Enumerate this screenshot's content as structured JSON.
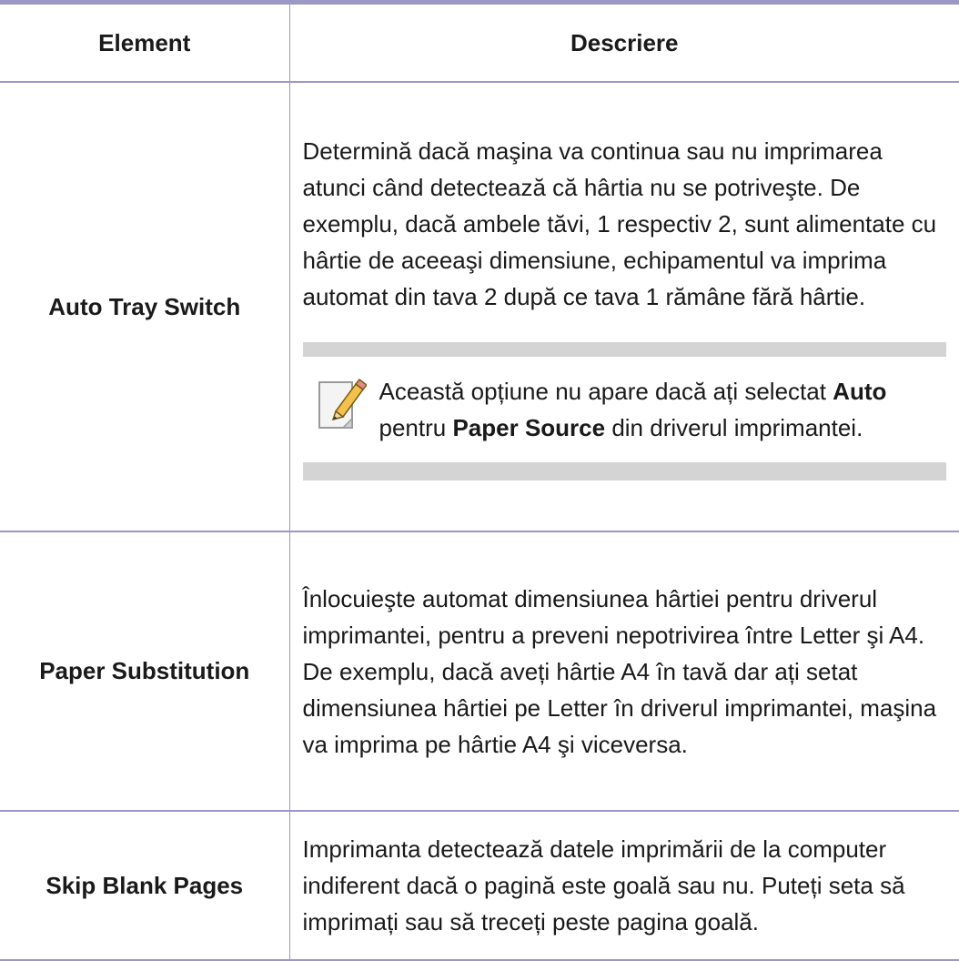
{
  "table": {
    "headers": {
      "element": "Element",
      "description": "Descriere"
    },
    "rows": [
      {
        "element": "Auto Tray Switch",
        "description": "Determină dacă maşina va continua sau nu imprimarea atunci când detectează că hârtia nu se potriveşte. De exemplu, dacă ambele tăvi, 1 respectiv 2, sunt alimentate cu hârtie de aceeaşi dimensiune, echipamentul va imprima automat din tava 2 după ce tava 1 rămâne fără hârtie.",
        "note": {
          "icon": "note-pencil-icon",
          "text_before": "Această opțiune nu apare dacă ați selectat ",
          "bold_1": "Auto",
          "text_middle": " pentru ",
          "bold_2": "Paper Source",
          "text_after": " din driverul imprimantei."
        }
      },
      {
        "element": "Paper Substitution",
        "description": "Înlocuieşte automat dimensiunea hârtiei pentru driverul imprimantei, pentru a preveni nepotrivirea între Letter şi A4. De exemplu, dacă aveți hârtie A4 în tavă dar ați setat dimensiunea hârtiei pe Letter în driverul imprimantei, maşina va imprima pe hârtie A4 şi viceversa."
      },
      {
        "element": "Skip Blank Pages",
        "description": "Imprimanta detectează datele imprimării de la computer indiferent dacă o pagină este goală sau nu. Puteți seta să imprimați sau să treceți peste pagina goală."
      }
    ]
  },
  "colors": {
    "rule": "#9b97c6",
    "note_frame": "#d4d4d4",
    "text": "#1a1a1a"
  }
}
